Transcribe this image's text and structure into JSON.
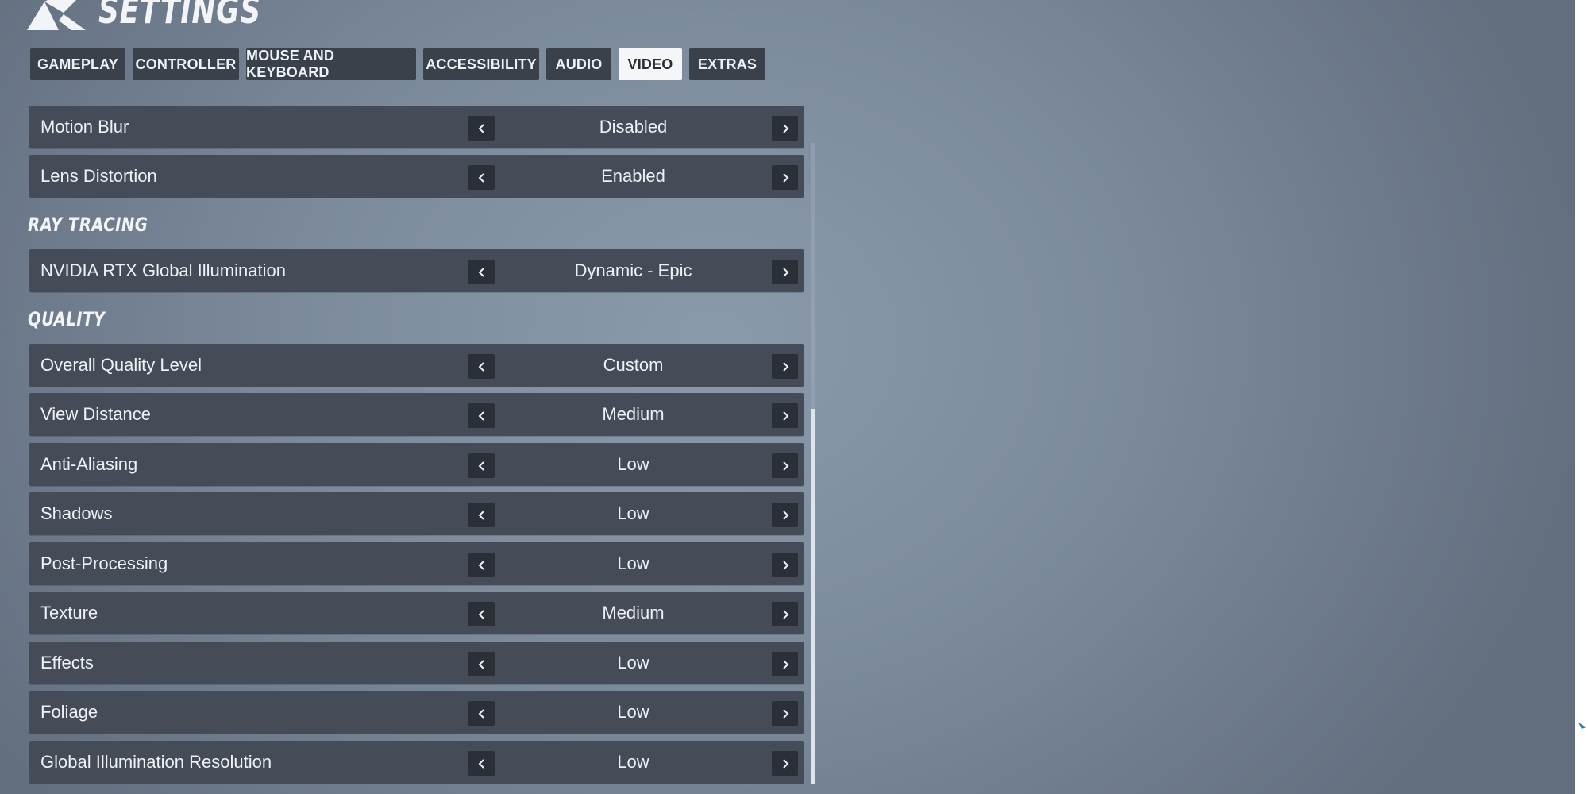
{
  "app": {
    "title": "SETTINGS"
  },
  "tabs": [
    {
      "label": "GAMEPLAY",
      "active": false
    },
    {
      "label": "CONTROLLER",
      "active": false
    },
    {
      "label": "MOUSE AND KEYBOARD",
      "active": false
    },
    {
      "label": "ACCESSIBILITY",
      "active": false
    },
    {
      "label": "AUDIO",
      "active": false
    },
    {
      "label": "VIDEO",
      "active": true
    },
    {
      "label": "EXTRAS",
      "active": false
    }
  ],
  "sections": {
    "ray_tracing": "RAY TRACING",
    "quality": "QUALITY"
  },
  "settings": {
    "motion_blur": {
      "label": "Motion Blur",
      "value": "Disabled"
    },
    "lens_distortion": {
      "label": "Lens Distortion",
      "value": "Enabled"
    },
    "rtx_gi": {
      "label": "NVIDIA RTX Global Illumination",
      "value": "Dynamic - Epic"
    },
    "overall_quality": {
      "label": "Overall Quality Level",
      "value": "Custom"
    },
    "view_distance": {
      "label": "View Distance",
      "value": "Medium"
    },
    "anti_aliasing": {
      "label": "Anti-Aliasing",
      "value": "Low"
    },
    "shadows": {
      "label": "Shadows",
      "value": "Low"
    },
    "post_processing": {
      "label": "Post-Processing",
      "value": "Low"
    },
    "texture": {
      "label": "Texture",
      "value": "Medium"
    },
    "effects": {
      "label": "Effects",
      "value": "Low"
    },
    "foliage": {
      "label": "Foliage",
      "value": "Low"
    },
    "gi_resolution": {
      "label": "Global Illumination Resolution",
      "value": "Low"
    }
  },
  "icons": {
    "logo": "game-logo-icon",
    "prev": "chevron-left-icon",
    "next": "chevron-right-icon"
  },
  "colors": {
    "row_bg": "#454b57",
    "tab_bg": "#3b414b",
    "tab_active_bg": "#f5f6f8",
    "arrow_bg": "#2b2f37",
    "text": "#eef1f5"
  }
}
